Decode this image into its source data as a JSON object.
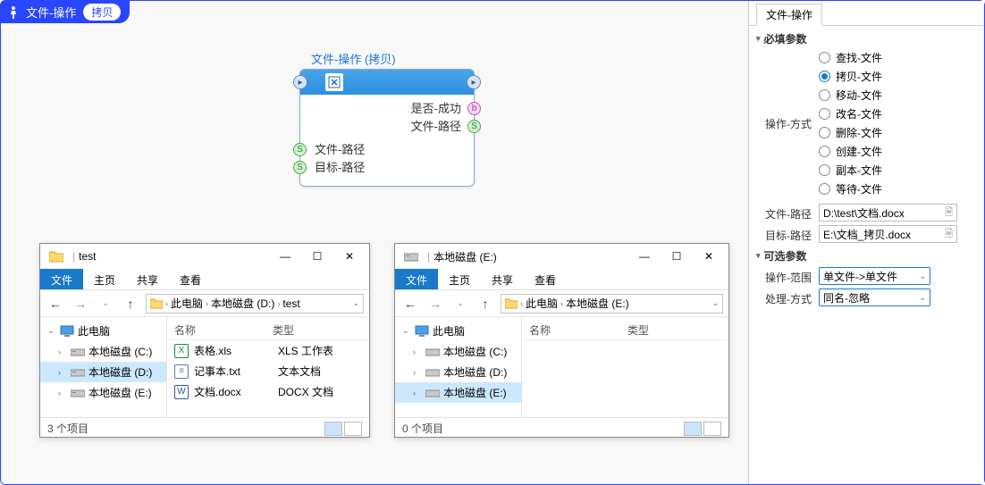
{
  "tag": {
    "icon": "person-icon",
    "title": "文件-操作",
    "pill": "拷贝"
  },
  "node": {
    "title": "文件-操作 (拷贝)",
    "outputs": [
      {
        "label": "是否-成功",
        "type": "b"
      },
      {
        "label": "文件-路径",
        "type": "S"
      }
    ],
    "inputs": [
      {
        "label": "文件-路径",
        "type": "S"
      },
      {
        "label": "目标-路径",
        "type": "S"
      }
    ]
  },
  "explorer1": {
    "title": "test",
    "ribbon": {
      "file": "文件",
      "home": "主页",
      "share": "共享",
      "view": "查看"
    },
    "breadcrumbs": [
      "此电脑",
      "本地磁盘 (D:)",
      "test"
    ],
    "tree": {
      "root": "此电脑",
      "drives": [
        "本地磁盘 (C:)",
        "本地磁盘 (D:)",
        "本地磁盘 (E:)"
      ],
      "selected": 1
    },
    "columns": {
      "name": "名称",
      "type": "类型"
    },
    "files": [
      {
        "name": "表格.xls",
        "type": "XLS 工作表",
        "color": "#1a8a3a"
      },
      {
        "name": "记事本.txt",
        "type": "文本文档",
        "color": "#5a7aa8"
      },
      {
        "name": "文档.docx",
        "type": "DOCX 文档",
        "color": "#2a5aa8"
      }
    ],
    "status": "3 个项目"
  },
  "explorer2": {
    "title": "本地磁盘 (E:)",
    "ribbon": {
      "file": "文件",
      "home": "主页",
      "share": "共享",
      "view": "查看"
    },
    "breadcrumbs": [
      "此电脑",
      "本地磁盘 (E:)"
    ],
    "tree": {
      "root": "此电脑",
      "drives": [
        "本地磁盘 (C:)",
        "本地磁盘 (D:)",
        "本地磁盘 (E:)"
      ],
      "selected": 2
    },
    "columns": {
      "name": "名称",
      "type": "类型"
    },
    "status": "0 个项目"
  },
  "panel": {
    "tab": "文件-操作",
    "required_head": "必填参数",
    "optional_head": "可选参数",
    "op_mode_label": "操作-方式",
    "op_modes": [
      "查找-文件",
      "拷贝-文件",
      "移动-文件",
      "改名-文件",
      "删除-文件",
      "创建-文件",
      "副本-文件",
      "等待-文件"
    ],
    "op_selected": 1,
    "file_path_label": "文件-路径",
    "file_path_value": "D:\\test\\文档.docx",
    "target_path_label": "目标-路径",
    "target_path_value": "E:\\文档_拷贝.docx",
    "scope_label": "操作-范围",
    "scope_value": "单文件->单文件",
    "handle_label": "处理-方式",
    "handle_value": "同名-忽略"
  }
}
